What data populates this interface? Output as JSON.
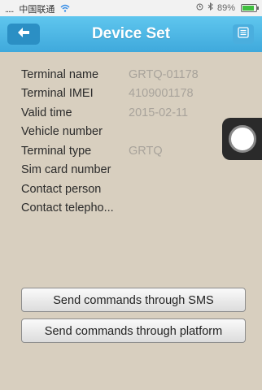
{
  "status_bar": {
    "carrier": "中国联通",
    "battery_text": "89%",
    "battery_level": 0.89
  },
  "navbar": {
    "title": "Device Set",
    "back_icon": "back-arrow-icon",
    "menu_icon": "list-icon"
  },
  "info": {
    "rows": [
      {
        "label": "Terminal name",
        "value": "GRTQ-01178"
      },
      {
        "label": "Terminal IMEI",
        "value": "4109001178"
      },
      {
        "label": "Valid time",
        "value": "2015-02-11"
      },
      {
        "label": "Vehicle number",
        "value": ""
      },
      {
        "label": "Terminal type",
        "value": "GRTQ"
      },
      {
        "label": "Sim card number",
        "value": ""
      },
      {
        "label": "Contact person",
        "value": ""
      },
      {
        "label": "Contact telepho...",
        "value": ""
      }
    ]
  },
  "buttons": {
    "sms_label": "Send commands through SMS",
    "platform_label": "Send commands through platform"
  },
  "colors": {
    "background": "#d8cfbf",
    "navbar": "#4fb6e6",
    "value_text": "#a8a39b"
  }
}
